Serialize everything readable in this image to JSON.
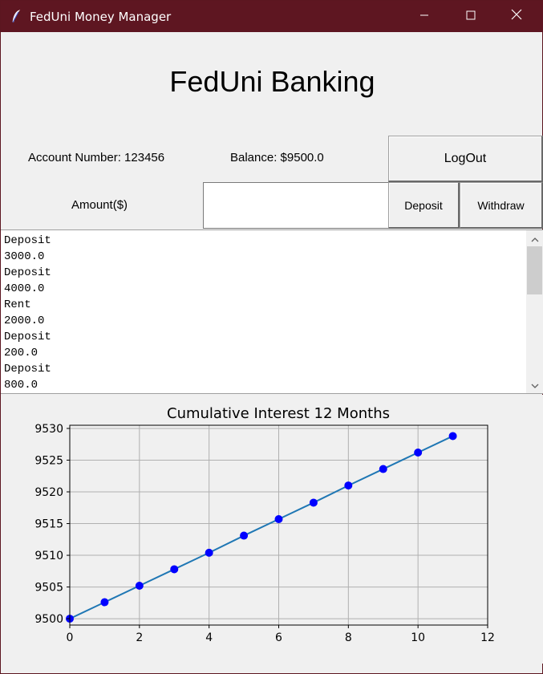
{
  "window": {
    "title": "FedUni Money Manager",
    "controls": {
      "minimize": "minimize-icon",
      "maximize": "maximize-icon",
      "close": "close-icon"
    },
    "titlebar_color": "#5e1621"
  },
  "header": {
    "title": "FedUni Banking"
  },
  "account": {
    "number_label": "Account Number: 123456",
    "balance_label": "Balance: $9500.0"
  },
  "buttons": {
    "logout": "LogOut",
    "deposit": "Deposit",
    "withdraw": "Withdraw"
  },
  "amount": {
    "label": "Amount($)",
    "value": ""
  },
  "transactions": [
    "Deposit",
    "3000.0",
    "Deposit",
    "4000.0",
    "Rent",
    "2000.0",
    "Deposit",
    "200.0",
    "Deposit",
    "800.0"
  ],
  "chart_data": {
    "type": "line",
    "title": "Cumulative Interest 12 Months",
    "xlabel": "",
    "ylabel": "",
    "x": [
      0,
      1,
      2,
      3,
      4,
      5,
      6,
      7,
      8,
      9,
      10,
      11
    ],
    "series": [
      {
        "values": [
          9500.0,
          9502.6,
          9505.2,
          9507.8,
          9510.4,
          9513.1,
          9515.7,
          9518.3,
          9521.0,
          9523.6,
          9526.2,
          9528.8
        ]
      }
    ],
    "xlim": [
      0,
      12
    ],
    "ylim": [
      9499,
      9530.5
    ],
    "xticks": [
      0,
      2,
      4,
      6,
      8,
      10,
      12
    ],
    "yticks": [
      9500,
      9505,
      9510,
      9515,
      9520,
      9525,
      9530
    ],
    "grid": true,
    "line_color": "#1f77b4",
    "marker_color": "#0000ff"
  }
}
